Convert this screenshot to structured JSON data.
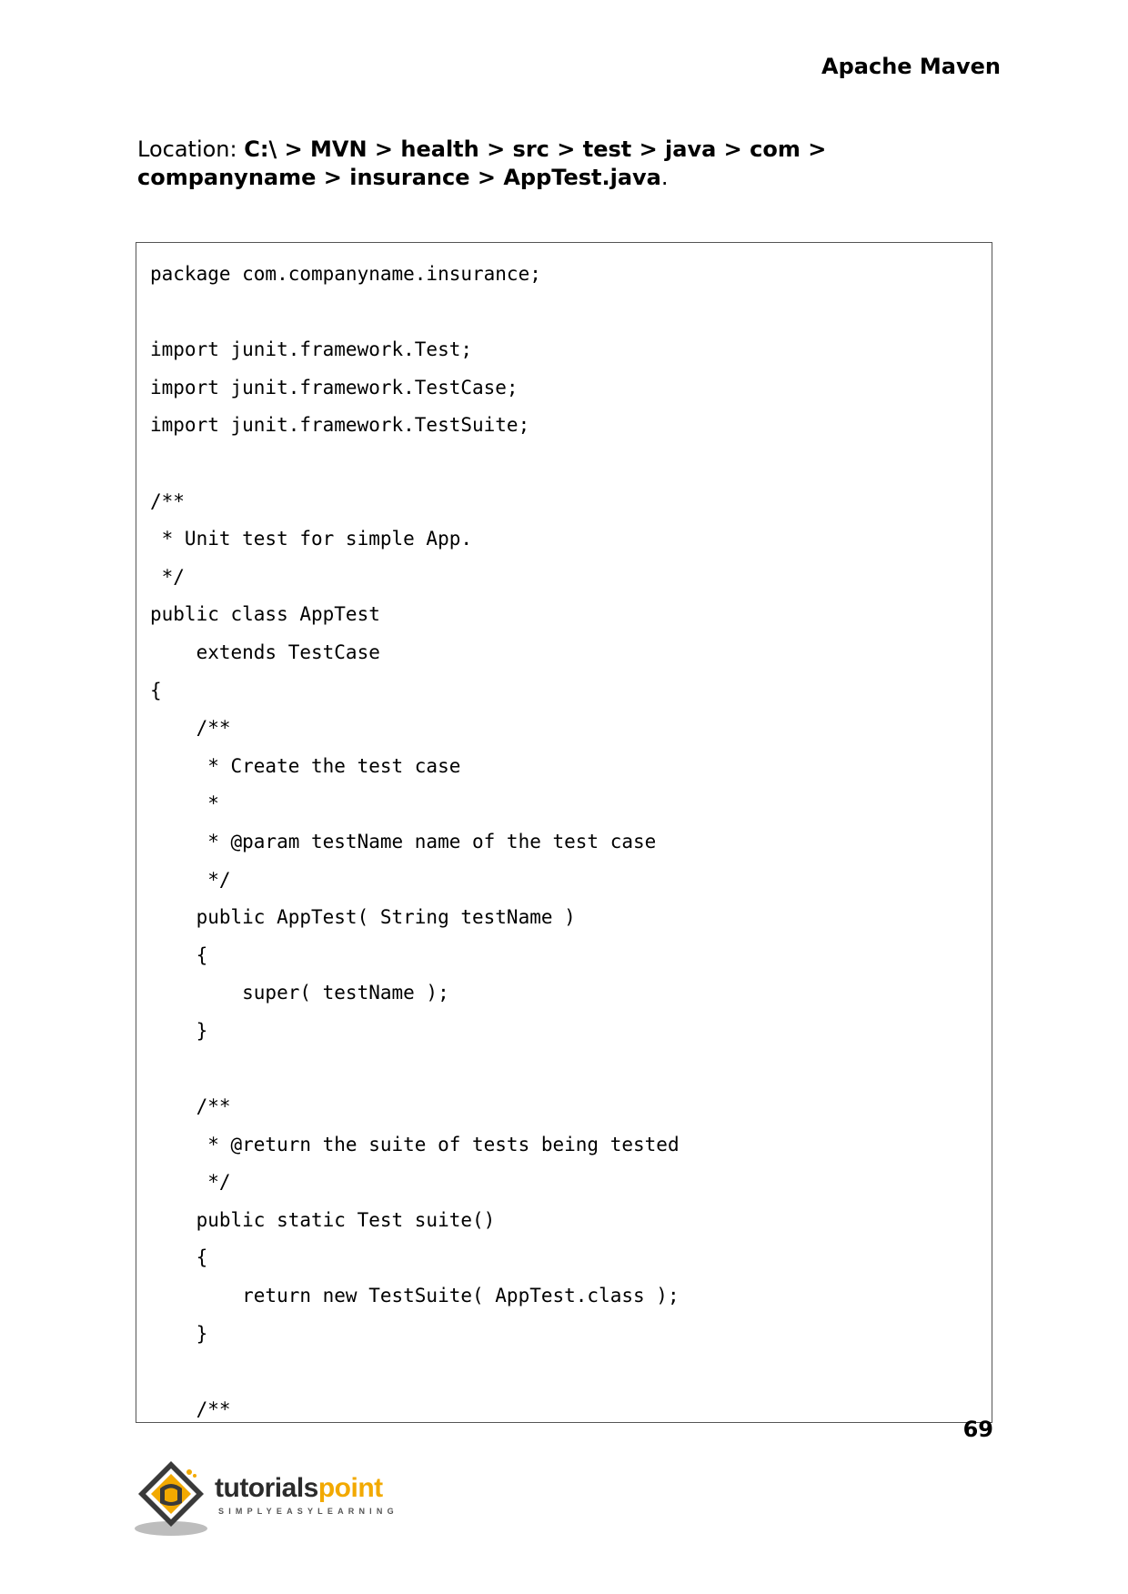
{
  "header": {
    "title": "Apache Maven"
  },
  "location": {
    "label": "Location: ",
    "path": "C:\\ > MVN > health > src > test > java > com > companyname > insurance > AppTest.java",
    "suffix": "."
  },
  "code": {
    "lines": [
      "package com.companyname.insurance;",
      "",
      "import junit.framework.Test;",
      "import junit.framework.TestCase;",
      "import junit.framework.TestSuite;",
      "",
      "/**",
      " * Unit test for simple App.",
      " */",
      "public class AppTest",
      "    extends TestCase",
      "{",
      "    /**",
      "     * Create the test case",
      "     *",
      "     * @param testName name of the test case",
      "     */",
      "    public AppTest( String testName )",
      "    {",
      "        super( testName );",
      "    }",
      "",
      "    /**",
      "     * @return the suite of tests being tested",
      "     */",
      "    public static Test suite()",
      "    {",
      "        return new TestSuite( AppTest.class );",
      "    }",
      "",
      "    /**"
    ]
  },
  "footer": {
    "page_number": "69",
    "logo": {
      "word1": "tutorials",
      "word2": "point",
      "tagline": "SIMPLYEASYLEARNING",
      "icon": "tutorialspoint-logo-icon",
      "accent_color": "#f2a900"
    }
  }
}
